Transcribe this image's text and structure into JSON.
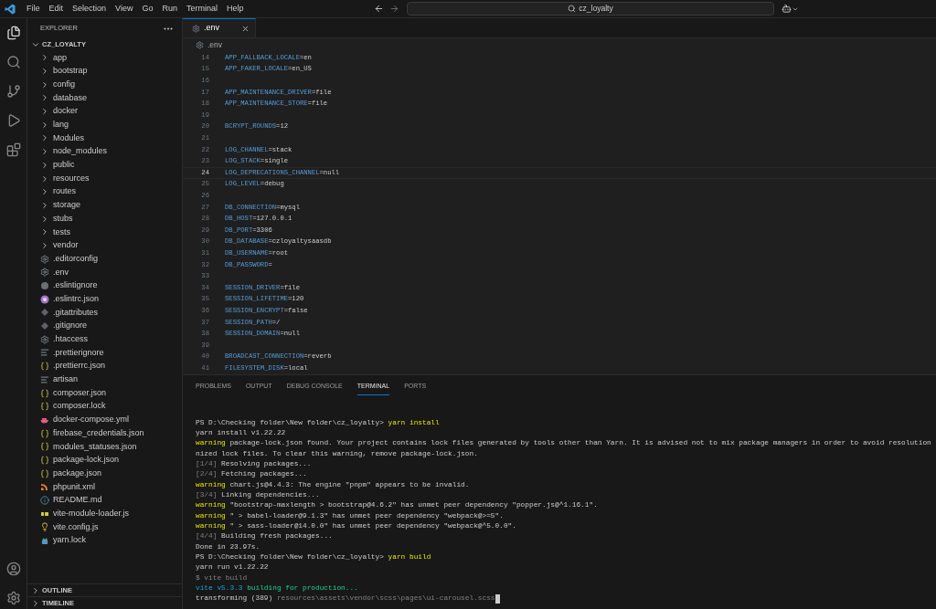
{
  "menu_bar": {
    "items": [
      "File",
      "Edit",
      "Selection",
      "View",
      "Go",
      "Run",
      "Terminal",
      "Help"
    ]
  },
  "command_center": {
    "text": "cz_loyalty"
  },
  "explorer": {
    "title": "EXPLORER",
    "root": {
      "label": "CZ_LOYALTY",
      "expanded": true,
      "children": [
        {
          "label": "app",
          "kind": "folder",
          "expanded": false
        },
        {
          "label": "bootstrap",
          "kind": "folder",
          "expanded": false
        },
        {
          "label": "config",
          "kind": "folder",
          "expanded": false
        },
        {
          "label": "database",
          "kind": "folder",
          "expanded": false
        },
        {
          "label": "docker",
          "kind": "folder",
          "expanded": false
        },
        {
          "label": "lang",
          "kind": "folder",
          "expanded": false
        },
        {
          "label": "Modules",
          "kind": "folder",
          "expanded": false
        },
        {
          "label": "node_modules",
          "kind": "folder",
          "expanded": false
        },
        {
          "label": "public",
          "kind": "folder",
          "expanded": false
        },
        {
          "label": "resources",
          "kind": "folder",
          "expanded": false
        },
        {
          "label": "routes",
          "kind": "folder",
          "expanded": false
        },
        {
          "label": "storage",
          "kind": "folder",
          "expanded": false
        },
        {
          "label": "stubs",
          "kind": "folder",
          "expanded": false
        },
        {
          "label": "tests",
          "kind": "folder",
          "expanded": false
        },
        {
          "label": "vendor",
          "kind": "folder",
          "expanded": false
        },
        {
          "label": ".editorconfig",
          "kind": "gear"
        },
        {
          "label": ".env",
          "kind": "gear"
        },
        {
          "label": ".eslintignore",
          "kind": "dot"
        },
        {
          "label": ".eslintrc.json",
          "kind": "eslint"
        },
        {
          "label": ".gitattributes",
          "kind": "diamond"
        },
        {
          "label": ".gitignore",
          "kind": "diamond"
        },
        {
          "label": ".htaccess",
          "kind": "gear"
        },
        {
          "label": ".prettierignore",
          "kind": "lines"
        },
        {
          "label": ".prettierrc.json",
          "kind": "json"
        },
        {
          "label": "artisan",
          "kind": "lines"
        },
        {
          "label": "composer.json",
          "kind": "json"
        },
        {
          "label": "composer.lock",
          "kind": "json"
        },
        {
          "label": "docker-compose.yml",
          "kind": "docker"
        },
        {
          "label": "firebase_credentials.json",
          "kind": "json"
        },
        {
          "label": "modules_statuses.json",
          "kind": "json"
        },
        {
          "label": "package-lock.json",
          "kind": "json"
        },
        {
          "label": "package.json",
          "kind": "json"
        },
        {
          "label": "phpunit.xml",
          "kind": "xml"
        },
        {
          "label": "README.md",
          "kind": "info"
        },
        {
          "label": "vite-module-loader.js",
          "kind": "js"
        },
        {
          "label": "vite.config.js",
          "kind": "bulb"
        },
        {
          "label": "yarn.lock",
          "kind": "yarn"
        }
      ]
    }
  },
  "sections": [
    {
      "label": "OUTLINE",
      "expanded": false
    },
    {
      "label": "TIMELINE",
      "expanded": false
    }
  ],
  "editor": {
    "tabs": [
      {
        "label": ".env",
        "selected": true
      }
    ],
    "breadcrumb": ".env",
    "lines": [
      {
        "num": "14",
        "text": "APP_FALLBACK_LOCALE=en",
        "current": false
      },
      {
        "num": "15",
        "text": "APP_FAKER_LOCALE=en_US",
        "current": false
      },
      {
        "num": "16",
        "current": false
      },
      {
        "num": "17",
        "text": "APP_MAINTENANCE_DRIVER=file",
        "current": false
      },
      {
        "num": "18",
        "text": "APP_MAINTENANCE_STORE=file",
        "current": false
      },
      {
        "num": "19",
        "current": false
      },
      {
        "num": "20",
        "text": "BCRYPT_ROUNDS=12",
        "current": false
      },
      {
        "num": "21",
        "current": false
      },
      {
        "num": "22",
        "text": "LOG_CHANNEL=stack",
        "current": false
      },
      {
        "num": "23",
        "text": "LOG_STACK=single",
        "current": false
      },
      {
        "num": "24",
        "text": "LOG_DEPRECATIONS_CHANNEL=null",
        "current": true
      },
      {
        "num": "25",
        "text": "LOG_LEVEL=debug",
        "current": false
      },
      {
        "num": "26",
        "current": false
      },
      {
        "num": "27",
        "text": "DB_CONNECTION=mysql",
        "current": false
      },
      {
        "num": "28",
        "text": "DB_HOST=127.0.0.1",
        "current": false
      },
      {
        "num": "29",
        "text": "DB_PORT=3306",
        "current": false
      },
      {
        "num": "30",
        "text": "DB_DATABASE=czloyaltysaasdb",
        "current": false
      },
      {
        "num": "31",
        "text": "DB_USERNAME=root",
        "current": false
      },
      {
        "num": "32",
        "text": "DB_PASSWORD=",
        "current": false
      },
      {
        "num": "33",
        "current": false
      },
      {
        "num": "34",
        "text": "SESSION_DRIVER=file",
        "current": false
      },
      {
        "num": "35",
        "text": "SESSION_LIFETIME=120",
        "current": false
      },
      {
        "num": "36",
        "text": "SESSION_ENCRYPT=false",
        "current": false
      },
      {
        "num": "37",
        "text": "SESSION_PATH=/",
        "current": false
      },
      {
        "num": "38",
        "text": "SESSION_DOMAIN=null",
        "current": false
      },
      {
        "num": "39",
        "current": false
      },
      {
        "num": "40",
        "text": "BROADCAST_CONNECTION=reverb",
        "current": false
      },
      {
        "num": "41",
        "text": "FILESYSTEM_DISK=local",
        "current": false
      }
    ]
  },
  "panel": {
    "tabs": [
      {
        "label": "PROBLEMS",
        "selected": false
      },
      {
        "label": "OUTPUT",
        "selected": false
      },
      {
        "label": "DEBUG CONSOLE",
        "selected": false
      },
      {
        "label": "TERMINAL",
        "selected": true
      },
      {
        "label": "PORTS",
        "selected": false
      }
    ],
    "terminal": [
      [
        {
          "text": "PS D:\\Checking folder\\New folder\\cz_loyalty> ",
          "kind": "plain"
        },
        {
          "text": "yarn install",
          "kind": "command"
        }
      ],
      [
        {
          "text": "yarn install v1.22.22",
          "kind": "plain"
        }
      ],
      [
        {
          "text": "warning",
          "kind": "warning"
        },
        {
          "text": " package-lock.json found. Your project contains lock files generated by tools other than Yarn. It is advised not to mix package managers in order to avoid resolution",
          "kind": "plain"
        }
      ],
      [
        {
          "text": "nized lock files. To clear this warning, remove package-lock.json.",
          "kind": "plain"
        }
      ],
      [
        {
          "text": "[1/4]",
          "kind": "dim"
        },
        {
          "text": " Resolving packages...",
          "kind": "plain"
        }
      ],
      [
        {
          "text": "[2/4]",
          "kind": "dim"
        },
        {
          "text": " Fetching packages...",
          "kind": "plain"
        }
      ],
      [
        {
          "text": "warning",
          "kind": "warning"
        },
        {
          "text": " chart.js@4.4.3: The engine \"pnpm\" appears to be invalid.",
          "kind": "plain"
        }
      ],
      [
        {
          "text": "[3/4]",
          "kind": "dim"
        },
        {
          "text": " Linking dependencies...",
          "kind": "plain"
        }
      ],
      [
        {
          "text": "warning",
          "kind": "warning"
        },
        {
          "text": " \"bootstrap-maxlength > bootstrap@4.6.2\" has unmet peer dependency \"popper.js@^1.16.1\".",
          "kind": "plain"
        }
      ],
      [
        {
          "text": "warning",
          "kind": "warning"
        },
        {
          "text": " \" > babel-loader@9.1.3\" has unmet peer dependency \"webpack@>=5\".",
          "kind": "plain"
        }
      ],
      [
        {
          "text": "warning",
          "kind": "warning"
        },
        {
          "text": " \" > sass-loader@14.0.0\" has unmet peer dependency \"webpack@^5.0.0\".",
          "kind": "plain"
        }
      ],
      [
        {
          "text": "[4/4]",
          "kind": "dim"
        },
        {
          "text": " Building fresh packages...",
          "kind": "plain"
        }
      ],
      [
        {
          "text": "Done in 23.97s.",
          "kind": "plain"
        }
      ],
      [
        {
          "text": "PS D:\\Checking folder\\New folder\\cz_loyalty> ",
          "kind": "plain"
        },
        {
          "text": "yarn build",
          "kind": "command"
        }
      ],
      [
        {
          "text": "yarn run v1.22.22",
          "kind": "plain"
        }
      ],
      [
        {
          "text": "$ vite build",
          "kind": "dim"
        }
      ],
      [
        {
          "text": "vite v5.3.3",
          "kind": "cyan"
        },
        {
          "text": " building for production...",
          "kind": "green"
        }
      ],
      [
        {
          "text": "transforming (389) ",
          "kind": "plain"
        },
        {
          "text": "resources\\assets\\vendor\\scss\\pages\\ui-carousel.scss",
          "kind": "dim"
        }
      ]
    ]
  }
}
